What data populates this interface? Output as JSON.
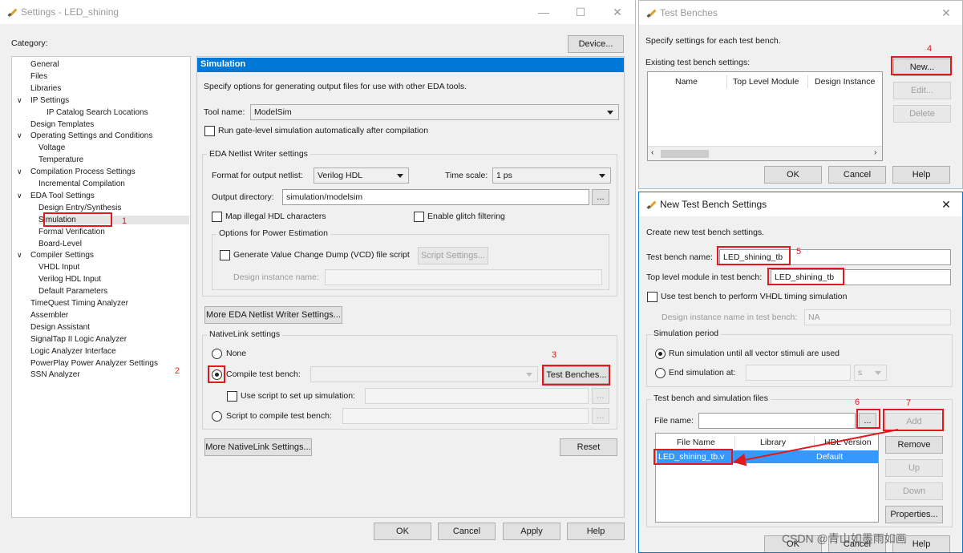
{
  "settings": {
    "title": "Settings - LED_shining",
    "category_label": "Category:",
    "device_button": "Device...",
    "tree": [
      {
        "label": "General",
        "indent": 0
      },
      {
        "label": "Files",
        "indent": 0
      },
      {
        "label": "Libraries",
        "indent": 0
      },
      {
        "label": "IP Settings",
        "indent": 0,
        "expander": "v"
      },
      {
        "label": "IP Catalog Search Locations",
        "indent": 2
      },
      {
        "label": "Design Templates",
        "indent": 0
      },
      {
        "label": "Operating Settings and Conditions",
        "indent": 0,
        "expander": "v"
      },
      {
        "label": "Voltage",
        "indent": 1
      },
      {
        "label": "Temperature",
        "indent": 1
      },
      {
        "label": "Compilation Process Settings",
        "indent": 0,
        "expander": "v"
      },
      {
        "label": "Incremental Compilation",
        "indent": 1
      },
      {
        "label": "EDA Tool Settings",
        "indent": 0,
        "expander": "v"
      },
      {
        "label": "Design Entry/Synthesis",
        "indent": 1
      },
      {
        "label": "Simulation",
        "indent": 1,
        "selected": true
      },
      {
        "label": "Formal Verification",
        "indent": 1
      },
      {
        "label": "Board-Level",
        "indent": 1
      },
      {
        "label": "Compiler Settings",
        "indent": 0,
        "expander": "v"
      },
      {
        "label": "VHDL Input",
        "indent": 1
      },
      {
        "label": "Verilog HDL Input",
        "indent": 1
      },
      {
        "label": "Default Parameters",
        "indent": 1
      },
      {
        "label": "TimeQuest Timing Analyzer",
        "indent": 0
      },
      {
        "label": "Assembler",
        "indent": 0
      },
      {
        "label": "Design Assistant",
        "indent": 0
      },
      {
        "label": "SignalTap II Logic Analyzer",
        "indent": 0
      },
      {
        "label": "Logic Analyzer Interface",
        "indent": 0
      },
      {
        "label": "PowerPlay Power Analyzer Settings",
        "indent": 0
      },
      {
        "label": "SSN Analyzer",
        "indent": 0
      }
    ],
    "panel_title": "Simulation",
    "panel_desc": "Specify options for generating output files for use with other EDA tools.",
    "tool_name_label": "Tool name:",
    "tool_name_value": "ModelSim",
    "run_gate_level": "Run gate-level simulation automatically after compilation",
    "eda_netlist_group": "EDA Netlist Writer settings",
    "format_label": "Format for output netlist:",
    "format_value": "Verilog HDL",
    "time_scale_label": "Time scale:",
    "time_scale_value": "1 ps",
    "output_dir_label": "Output directory:",
    "output_dir_value": "simulation/modelsim",
    "browse": "...",
    "map_illegal": "Map illegal HDL characters",
    "enable_glitch": "Enable glitch filtering",
    "power_group": "Options for Power Estimation",
    "gen_vcd": "Generate Value Change Dump (VCD) file script",
    "script_settings": "Script Settings...",
    "design_instance_name_label": "Design instance name:",
    "more_eda": "More EDA Netlist Writer Settings...",
    "nativelink_group": "NativeLink settings",
    "none": "None",
    "compile_tb": "Compile test bench:",
    "test_benches": "Test Benches...",
    "use_script": "Use script to set up simulation:",
    "script_compile": "Script to compile test bench:",
    "more_nativelink": "More NativeLink Settings...",
    "reset": "Reset",
    "ok": "OK",
    "cancel": "Cancel",
    "apply": "Apply",
    "help": "Help"
  },
  "test_benches": {
    "title": "Test Benches",
    "desc": "Specify settings for each test bench.",
    "existing_label": "Existing test bench settings:",
    "columns": [
      "Name",
      "Top Level Module",
      "Design Instance"
    ],
    "new": "New...",
    "edit": "Edit...",
    "delete": "Delete",
    "ok": "OK",
    "cancel": "Cancel",
    "help": "Help"
  },
  "new_tb": {
    "title": "New Test Bench Settings",
    "desc": "Create new test bench settings.",
    "tb_name_label": "Test bench name:",
    "tb_name_value": "LED_shining_tb",
    "top_module_label": "Top level module in test bench:",
    "top_module_value": "LED_shining_tb",
    "use_vhdl_timing": "Use test bench to perform VHDL timing simulation",
    "design_instance_label": "Design instance name in test bench:",
    "design_instance_value": "NA",
    "sim_period_group": "Simulation period",
    "run_until": "Run simulation until all vector stimuli are used",
    "end_sim_at": "End simulation at:",
    "end_unit": "s",
    "files_group": "Test bench and simulation files",
    "file_name_label": "File name:",
    "browse": "...",
    "add": "Add",
    "columns": [
      "File Name",
      "Library",
      "HDL Version"
    ],
    "files": [
      {
        "name": "LED_shining_tb.v",
        "library": "",
        "hdl": "Default"
      }
    ],
    "remove": "Remove",
    "up": "Up",
    "down": "Down",
    "properties": "Properties...",
    "ok": "OK",
    "cancel": "Cancel",
    "help": "Help"
  },
  "annotations": [
    "1",
    "2",
    "3",
    "4",
    "5",
    "6",
    "7"
  ],
  "watermark": "CSDN @青山如墨雨如画",
  "colors": {
    "annotation_red": "#e0191e",
    "selection_blue": "#3399ff",
    "panel_header_blue": "#0078d7"
  }
}
